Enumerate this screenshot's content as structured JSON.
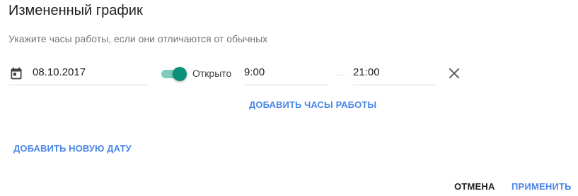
{
  "dialog": {
    "title": "Измененный график",
    "subtitle": "Укажите часы работы, если они отличаются от обычных"
  },
  "schedule_row": {
    "date_value": "08.10.2017",
    "calendar_icon": "calendar-icon",
    "toggle_state": "on",
    "toggle_label": "Открыто",
    "open_time": "9:00",
    "close_time": "21:00",
    "remove_icon": "close-icon",
    "accent_color": "#0c8f79"
  },
  "links": {
    "add_hours": "ДОБАВИТЬ ЧАСЫ РАБОТЫ",
    "add_date": "ДОБАВИТЬ НОВУЮ ДАТУ",
    "link_color": "#4a86e8"
  },
  "actions": {
    "cancel": "ОТМЕНА",
    "apply": "ПРИМЕНИТЬ"
  }
}
